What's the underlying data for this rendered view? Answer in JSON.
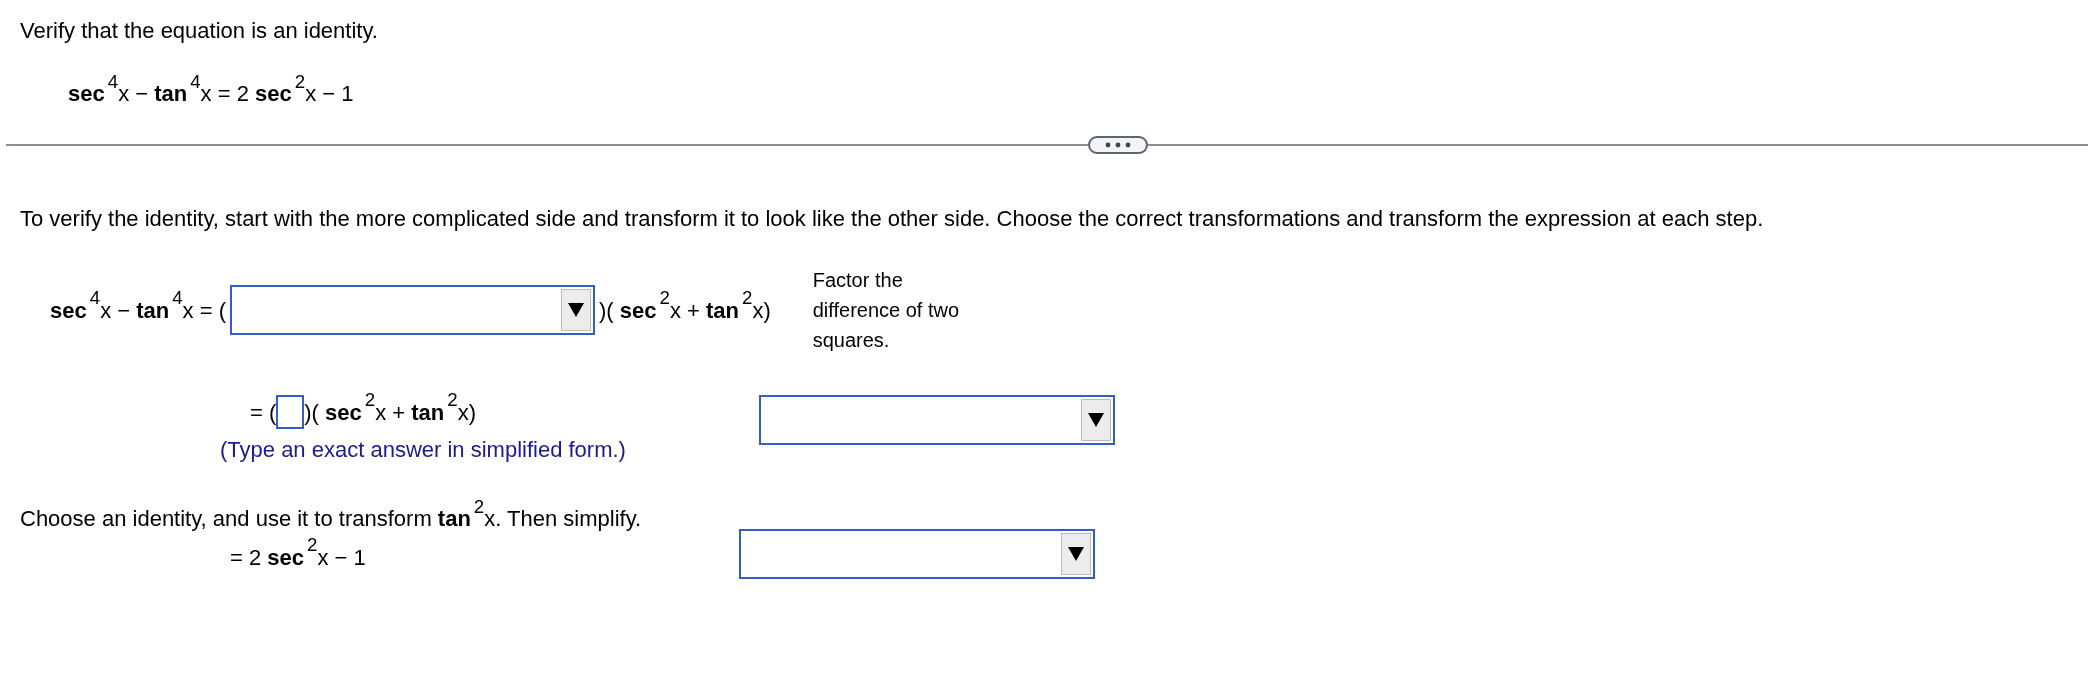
{
  "prompt": "Verify that the equation is an identity.",
  "equation": "**sec**$^{4}$x − **tan**$^{4}$x = 2 **sec**$^{2}$x − 1",
  "instruction": "To verify the identity, start with the more complicated side and transform it to look like the other side. Choose the correct transformations and transform the expression at each step.",
  "steps": [
    {
      "kind": "factor",
      "before": "**sec**$^{4}$x − **tan**$^{4}$x = (",
      "after": ")( **sec**$^{2}$x + **tan**$^{2}$x)",
      "note": "Factor the difference of two squares."
    },
    {
      "kind": "answer",
      "before": "= (",
      "after": ")( **sec**$^{2}$x + **tan**$^{2}$x)",
      "hint": "(Type an exact answer in simplified form.)"
    },
    {
      "kind": "identity",
      "text": "Choose an identity, and use it to transform **tan**$^{2}$x. Then simplify.",
      "result": "= 2 **sec**$^{2}$x − 1"
    }
  ]
}
